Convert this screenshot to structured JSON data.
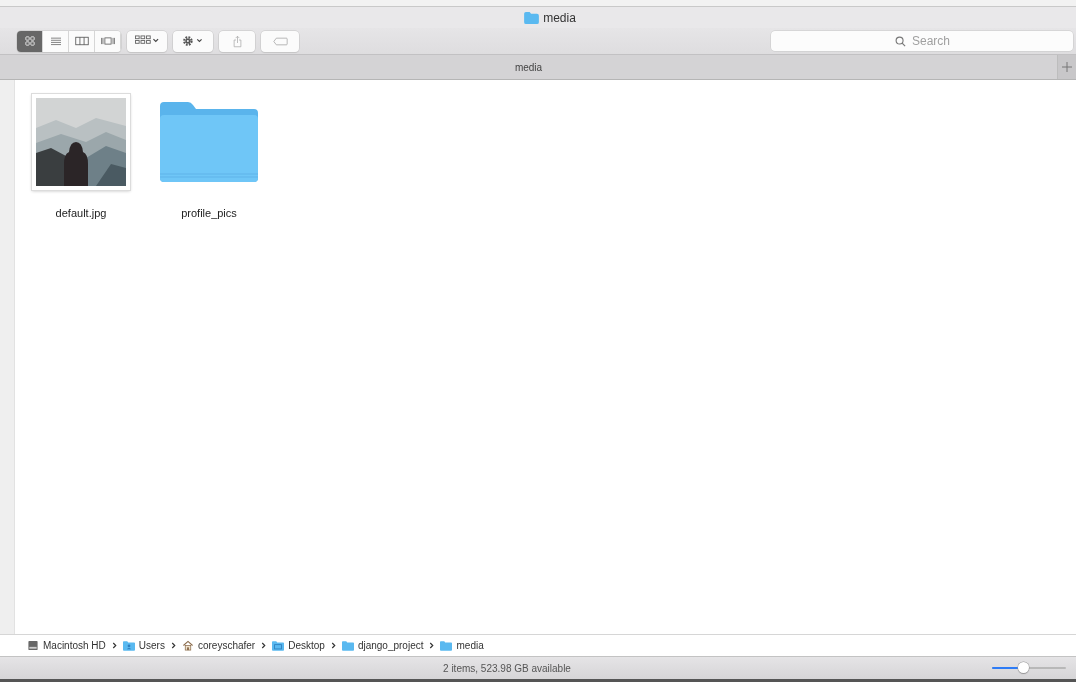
{
  "window": {
    "title": "media"
  },
  "toolbar": {
    "view_modes": [
      {
        "kind": "icons",
        "selected": true
      },
      {
        "kind": "list",
        "selected": false
      },
      {
        "kind": "columns",
        "selected": false
      },
      {
        "kind": "gallery",
        "selected": false
      }
    ]
  },
  "search": {
    "placeholder": "Search"
  },
  "tab": {
    "label": "media"
  },
  "items": [
    {
      "name": "default.jpg",
      "kind": "picture"
    },
    {
      "name": "profile_pics",
      "kind": "folder"
    }
  ],
  "path": [
    {
      "label": "Macintosh HD",
      "kind": "disk"
    },
    {
      "label": "Users",
      "kind": "users"
    },
    {
      "label": "coreyschafer",
      "kind": "home"
    },
    {
      "label": "Desktop",
      "kind": "desktop"
    },
    {
      "label": "django_project",
      "kind": "folder"
    },
    {
      "label": "media",
      "kind": "folder"
    }
  ],
  "status": "2 items, 523.98 GB available",
  "zoom_slider": {
    "level": 0.42
  }
}
